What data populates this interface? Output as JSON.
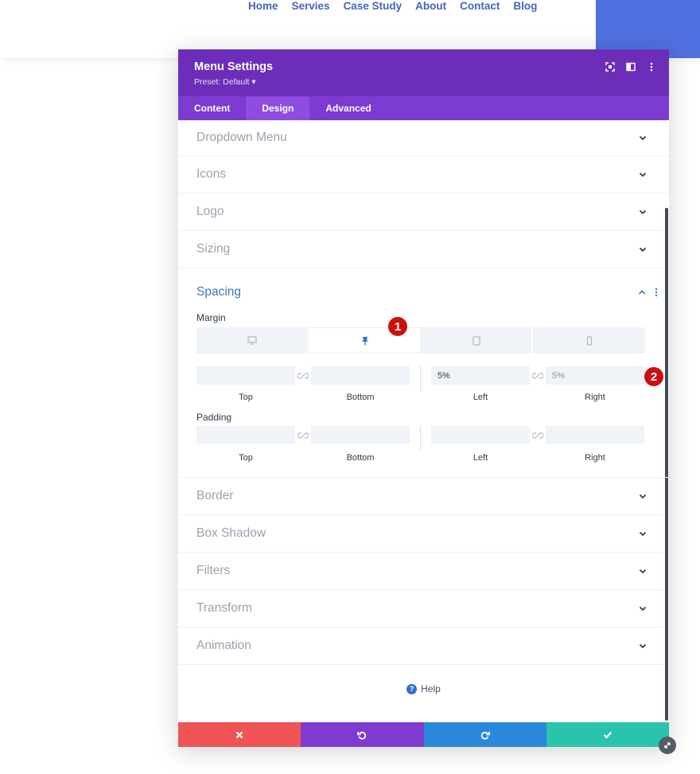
{
  "site": {
    "nav": [
      "Home",
      "Servies",
      "Case Study",
      "About",
      "Contact",
      "Blog"
    ],
    "accent_color": "#5170e0"
  },
  "modal": {
    "title": "Menu Settings",
    "preset": "Preset: Default ▾",
    "header_icons": [
      "focus-icon",
      "split-view-icon",
      "more-vertical-icon"
    ],
    "tabs": [
      {
        "label": "Content",
        "active": false
      },
      {
        "label": "Design",
        "active": true
      },
      {
        "label": "Advanced",
        "active": false
      }
    ],
    "sections_top": [
      "Dropdown Menu",
      "Icons",
      "Logo",
      "Sizing"
    ],
    "spacing": {
      "title": "Spacing",
      "margin_label": "Margin",
      "padding_label": "Padding",
      "devices": [
        "desktop-icon",
        "pin-icon",
        "tablet-icon",
        "phone-icon"
      ],
      "margin": {
        "top": "",
        "bottom": "",
        "left": "5%",
        "right": "5%"
      },
      "padding": {
        "top": "",
        "bottom": "",
        "left": "",
        "right": ""
      },
      "captions": {
        "top": "Top",
        "bottom": "Bottom",
        "left": "Left",
        "right": "Right"
      }
    },
    "sections_bottom": [
      "Border",
      "Box Shadow",
      "Filters",
      "Transform",
      "Animation"
    ],
    "help_label": "Help",
    "footer": [
      {
        "icon": "close-icon",
        "color": "#ef5555"
      },
      {
        "icon": "undo-icon",
        "color": "#7e3bd0"
      },
      {
        "icon": "redo-icon",
        "color": "#2b87da"
      },
      {
        "icon": "check-icon",
        "color": "#29c4a9"
      }
    ],
    "header_color": "#6c2eb9"
  },
  "badges": [
    "1",
    "2"
  ]
}
